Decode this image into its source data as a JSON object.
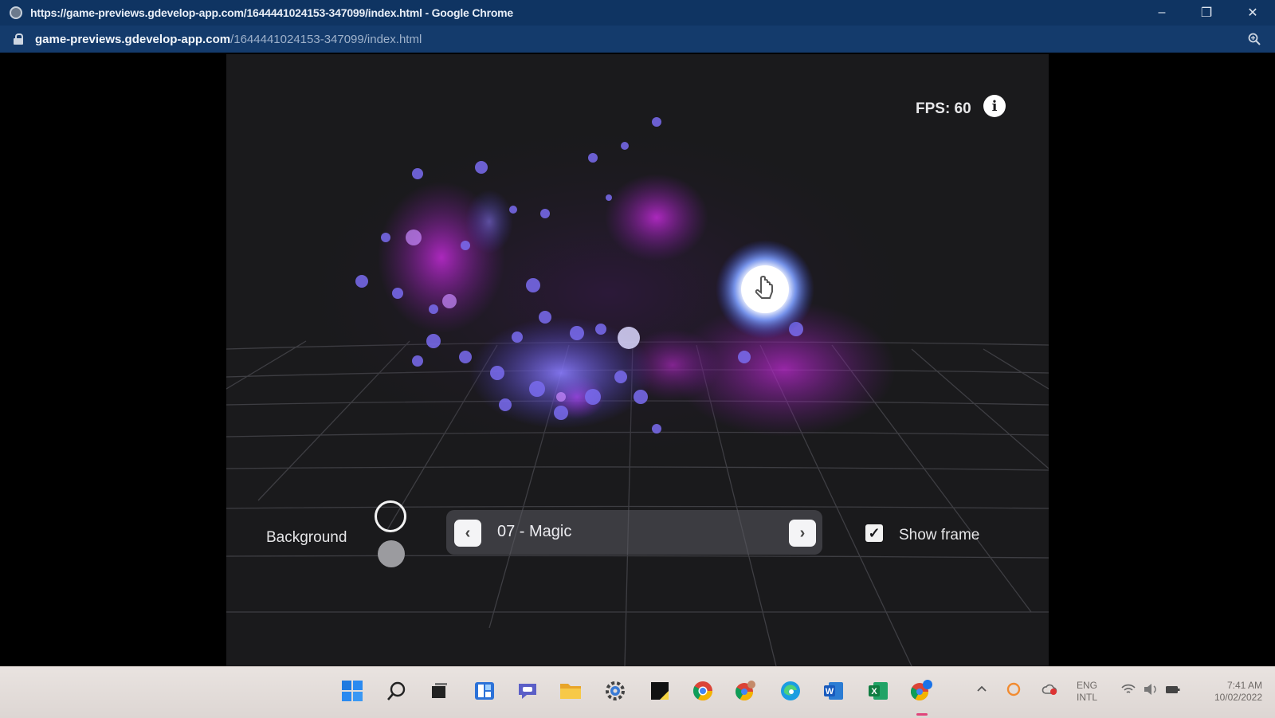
{
  "window": {
    "title": "https://game-previews.gdevelop-app.com/1644441024153-347099/index.html - Google Chrome",
    "url_host": "game-previews.gdevelop-app.com",
    "url_path": "/1644441024153-347099/index.html",
    "controls": {
      "minimize": "–",
      "restore": "❐",
      "close": "✕"
    }
  },
  "game": {
    "fps_label": "FPS: 60",
    "info_glyph": "i",
    "background_label": "Background",
    "effect_name": "07 - Magic",
    "prev_glyph": "‹",
    "next_glyph": "›",
    "show_frame_label": "Show frame",
    "show_frame_checked": true,
    "check_glyph": "✓"
  },
  "taskbar": {
    "icons": [
      "windows-start-icon",
      "search-icon",
      "task-view-icon",
      "widgets-icon",
      "teams-chat-icon",
      "file-explorer-icon",
      "settings-icon",
      "sticky-notes-icon",
      "chrome-icon",
      "chrome-profile-icon",
      "edge-icon",
      "word-icon",
      "excel-icon",
      "chrome-active-icon"
    ],
    "tray": {
      "lang_top": "ENG",
      "lang_bottom": "INTL",
      "time": "7:41 AM",
      "date": "10/02/2022"
    }
  }
}
